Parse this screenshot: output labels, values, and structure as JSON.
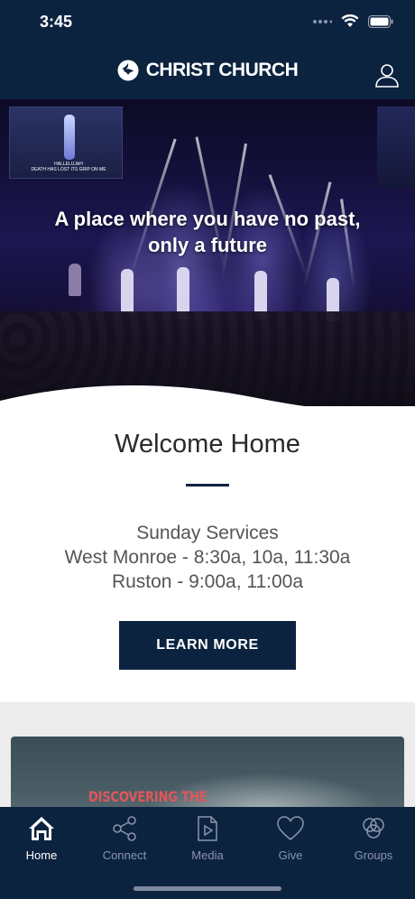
{
  "status_bar": {
    "time": "3:45"
  },
  "header": {
    "brand": "CHRIST CHURCH"
  },
  "hero": {
    "tagline_line1": "A place where you have no past,",
    "tagline_line2": "only a future",
    "screen_lyrics_1": "HALLELUJAH",
    "screen_lyrics_2": "DEATH HAS LOST ITS GRIP ON ME"
  },
  "welcome": {
    "title": "Welcome Home",
    "services_heading": "Sunday Services",
    "services_line1": "West Monroe - 8:30a, 10a, 11:30a",
    "services_line2": "Ruston - 9:00a, 11:00a",
    "button_label": "LEARN MORE"
  },
  "promo": {
    "text": "DISCOVERING THE"
  },
  "tabs": [
    {
      "label": "Home",
      "icon": "home-icon",
      "active": true
    },
    {
      "label": "Connect",
      "icon": "share-icon",
      "active": false
    },
    {
      "label": "Media",
      "icon": "media-icon",
      "active": false
    },
    {
      "label": "Give",
      "icon": "heart-icon",
      "active": false
    },
    {
      "label": "Groups",
      "icon": "groups-icon",
      "active": false
    }
  ],
  "colors": {
    "navy": "#0c2340",
    "inactive_tab": "#8a96ab",
    "promo_red": "#e0575a"
  }
}
